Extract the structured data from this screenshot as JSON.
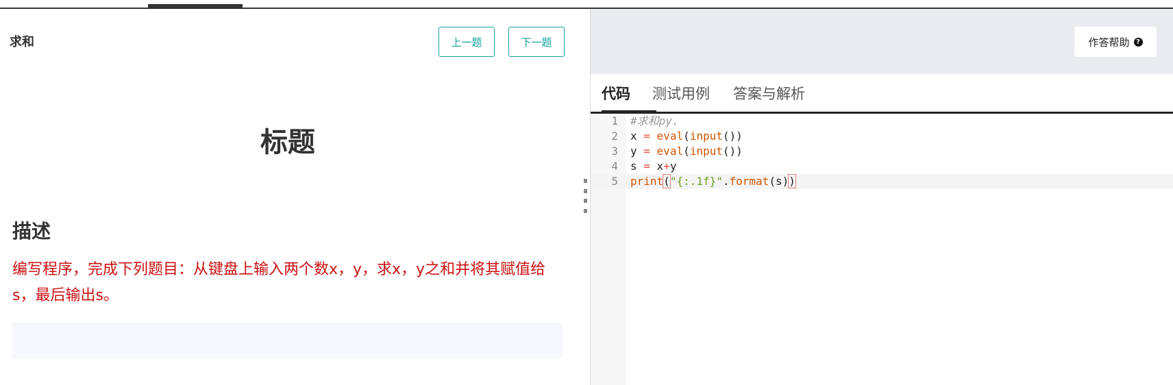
{
  "problem": {
    "title": "求和",
    "prev_label": "上一题",
    "next_label": "下一题",
    "heading": "标题",
    "description_label": "描述",
    "description": "编写程序，完成下列题目：从键盘上输入两个数x，y，求x，y之和并将其赋值给s，最后输出s。"
  },
  "toolbar": {
    "help_label": "作答帮助",
    "help_icon": "question-circle-icon"
  },
  "tabs": [
    {
      "label": "代码",
      "active": true
    },
    {
      "label": "测试用例",
      "active": false
    },
    {
      "label": "答案与解析",
      "active": false
    }
  ],
  "editor": {
    "lines": [
      {
        "number": "1",
        "tokens": [
          {
            "t": "#求和py.",
            "c": "comment"
          }
        ]
      },
      {
        "number": "2",
        "tokens": [
          {
            "t": "x ",
            "c": ""
          },
          {
            "t": "=",
            "c": "op"
          },
          {
            "t": " ",
            "c": ""
          },
          {
            "t": "eval",
            "c": "builtin"
          },
          {
            "t": "(",
            "c": ""
          },
          {
            "t": "input",
            "c": "builtin"
          },
          {
            "t": "())",
            "c": ""
          }
        ]
      },
      {
        "number": "3",
        "tokens": [
          {
            "t": "y ",
            "c": ""
          },
          {
            "t": "=",
            "c": "op"
          },
          {
            "t": " ",
            "c": ""
          },
          {
            "t": "eval",
            "c": "builtin"
          },
          {
            "t": "(",
            "c": ""
          },
          {
            "t": "input",
            "c": "builtin"
          },
          {
            "t": "())",
            "c": ""
          }
        ]
      },
      {
        "number": "4",
        "tokens": [
          {
            "t": "s ",
            "c": ""
          },
          {
            "t": "=",
            "c": "op"
          },
          {
            "t": " x",
            "c": ""
          },
          {
            "t": "+",
            "c": "op"
          },
          {
            "t": "y",
            "c": ""
          }
        ]
      },
      {
        "number": "5",
        "tokens": [
          {
            "t": "print",
            "c": "builtin"
          },
          {
            "t": "(",
            "c": "bracket"
          },
          {
            "t": "\"{:.1f}\"",
            "c": "str"
          },
          {
            "t": ".",
            "c": ""
          },
          {
            "t": "format",
            "c": "method"
          },
          {
            "t": "(s)",
            "c": ""
          },
          {
            "t": ")",
            "c": "bracket"
          }
        ]
      }
    ],
    "active_line": 5
  },
  "colors": {
    "accent": "#14a39a",
    "description_text": "#cc1111"
  }
}
